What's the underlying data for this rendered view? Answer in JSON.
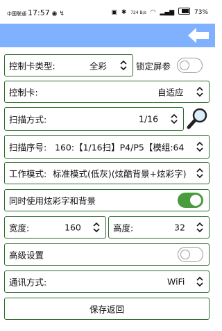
{
  "status_bar": {
    "carrier": "中国联通",
    "time": "17:57",
    "speed": "724 B/s",
    "battery": "73%",
    "battery_level": 0.73
  },
  "app_bar": {
    "back_icon": "arrow-left-icon",
    "color": "#7fb1ff"
  },
  "form": {
    "card_type": {
      "label": "控制卡类型:",
      "value": "全彩"
    },
    "lock_screen": {
      "label": "锁定屏参",
      "enabled": false
    },
    "control_card": {
      "label": "控制卡:",
      "value": "自适应"
    },
    "scan_mode": {
      "label": "扫描方式:",
      "value": "1/16",
      "search_icon": "search-icon"
    },
    "scan_order": {
      "label": "扫描序号:",
      "value": "160:【1/16扫】P4/P5【模组:64"
    },
    "work_mode": {
      "label": "工作模式:",
      "value": "标准模式(低灰)(炫酷背景+炫彩字)"
    },
    "colorful_bg": {
      "label": "同时使用炫彩字和背景",
      "enabled": true
    },
    "width": {
      "label": "宽度:",
      "value": "160"
    },
    "height": {
      "label": "高度:",
      "value": "32"
    },
    "advanced": {
      "label": "高级设置",
      "enabled": false
    },
    "comm_mode": {
      "label": "通讯方式:",
      "value": "WiFi"
    },
    "save_button": "保存返回"
  },
  "colors": {
    "row_border": "#2f6b2f",
    "toggle_on": "#4a9a3e"
  }
}
